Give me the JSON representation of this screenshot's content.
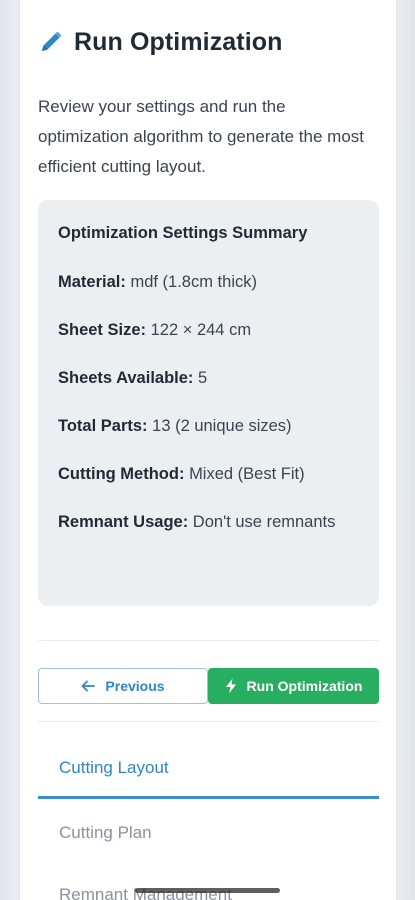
{
  "page": {
    "title": "Run Optimization",
    "title_icon": "pencil-icon",
    "intro": "Review your settings and run the optimization algorithm to generate the most efficient cutting layout."
  },
  "summary": {
    "heading": "Optimization Settings Summary",
    "rows": [
      {
        "label": "Material:",
        "value": "mdf (1.8cm thick)"
      },
      {
        "label": "Sheet Size:",
        "value": "122 × 244 cm"
      },
      {
        "label": "Sheets Available:",
        "value": "5"
      },
      {
        "label": "Total Parts:",
        "value": "13 (2 unique sizes)"
      },
      {
        "label": "Cutting Method:",
        "value": "Mixed (Best Fit)"
      },
      {
        "label": "Remnant Usage:",
        "value": "Don't use remnants"
      }
    ]
  },
  "actions": {
    "previous_label": "Previous",
    "previous_icon": "arrow-left-icon",
    "run_label": "Run Optimization",
    "run_icon": "lightning-bolt-icon"
  },
  "tabs": [
    {
      "label": "Cutting Layout",
      "active": true
    },
    {
      "label": "Cutting Plan",
      "active": false
    },
    {
      "label": "Remnant Management",
      "active": false
    }
  ],
  "colors": {
    "accent_blue": "#2f86c5",
    "run_green": "#27ae60",
    "summary_bg": "#eceff2"
  }
}
